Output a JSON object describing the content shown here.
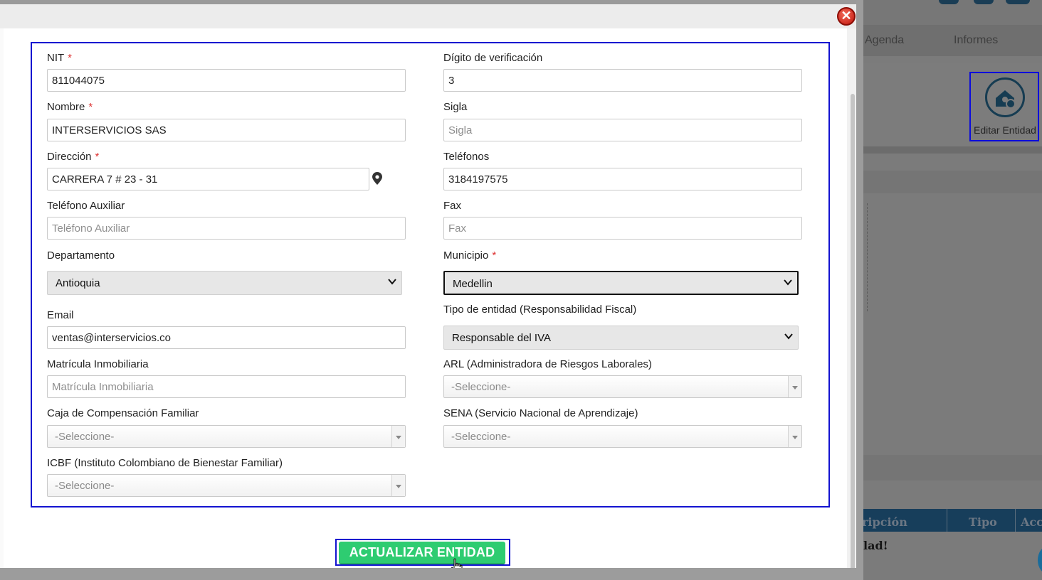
{
  "background": {
    "nav_items": [
      "Agenda",
      "Informes"
    ],
    "edit_entity_label": "Editar Entidad",
    "table_headers": [
      "ripción",
      "Tipo",
      "Acc"
    ],
    "row_text": "lad!"
  },
  "modal": {
    "close_symbol": "✕",
    "fields": {
      "nit": {
        "label": "NIT",
        "value": "811044075"
      },
      "digito": {
        "label": "Dígito de verificación",
        "value": "3"
      },
      "nombre": {
        "label": "Nombre",
        "value": "INTERSERVICIOS SAS"
      },
      "sigla": {
        "label": "Sigla",
        "placeholder": "Sigla"
      },
      "direccion": {
        "label": "Dirección",
        "value": "CARRERA 7 # 23 - 31"
      },
      "telefonos": {
        "label": "Teléfonos",
        "value": "3184197575"
      },
      "telefono_aux": {
        "label": "Teléfono Auxiliar",
        "placeholder": "Teléfono Auxiliar"
      },
      "fax": {
        "label": "Fax",
        "placeholder": "Fax"
      },
      "departamento": {
        "label": "Departamento",
        "value": "Antioquia"
      },
      "municipio": {
        "label": "Municipio",
        "value": "Medellin"
      },
      "email": {
        "label": "Email",
        "value": "ventas@interservicios.co"
      },
      "tipo_entidad": {
        "label": "Tipo de entidad (Responsabilidad Fiscal)",
        "value": "Responsable del IVA"
      },
      "matricula": {
        "label": "Matrícula Inmobiliaria",
        "placeholder": "Matrícula Inmobiliaria"
      },
      "arl": {
        "label": "ARL (Administradora de Riesgos Laborales)",
        "value": "-Seleccione-"
      },
      "caja": {
        "label": "Caja de Compensación Familiar",
        "value": "-Seleccione-"
      },
      "sena": {
        "label": "SENA (Servicio Nacional de Aprendizaje)",
        "value": "-Seleccione-"
      },
      "icbf": {
        "label": "ICBF (Instituto Colombiano de Bienestar Familiar)",
        "value": "-Seleccione-"
      }
    },
    "required_mark": "*",
    "submit_label": "ACTUALIZAR ENTIDAD"
  }
}
